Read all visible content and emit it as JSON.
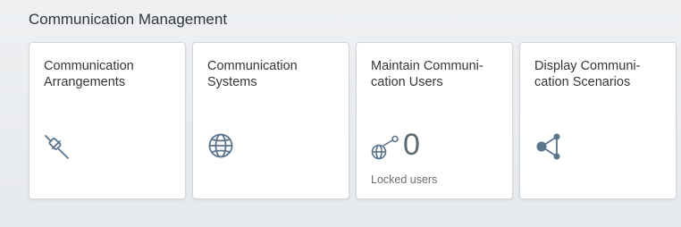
{
  "group": {
    "title": "Communication Management"
  },
  "tiles": [
    {
      "title_line1": "Communication",
      "title_line2": "Arrangements",
      "icon": "connection-icon"
    },
    {
      "title_line1": "Communication",
      "title_line2": "Systems",
      "icon": "globe-icon"
    },
    {
      "title_line1": "Maintain Communi-",
      "title_line2": "cation Users",
      "icon": "web-user-icon",
      "kpi_value": "0",
      "footer": "Locked users"
    },
    {
      "title_line1": "Display Communi-",
      "title_line2": "cation Scenarios",
      "icon": "share-icon"
    }
  ],
  "colors": {
    "icon": "#5b738b",
    "background": "#edeff0",
    "tile": "#ffffff",
    "text": "#32363a"
  }
}
